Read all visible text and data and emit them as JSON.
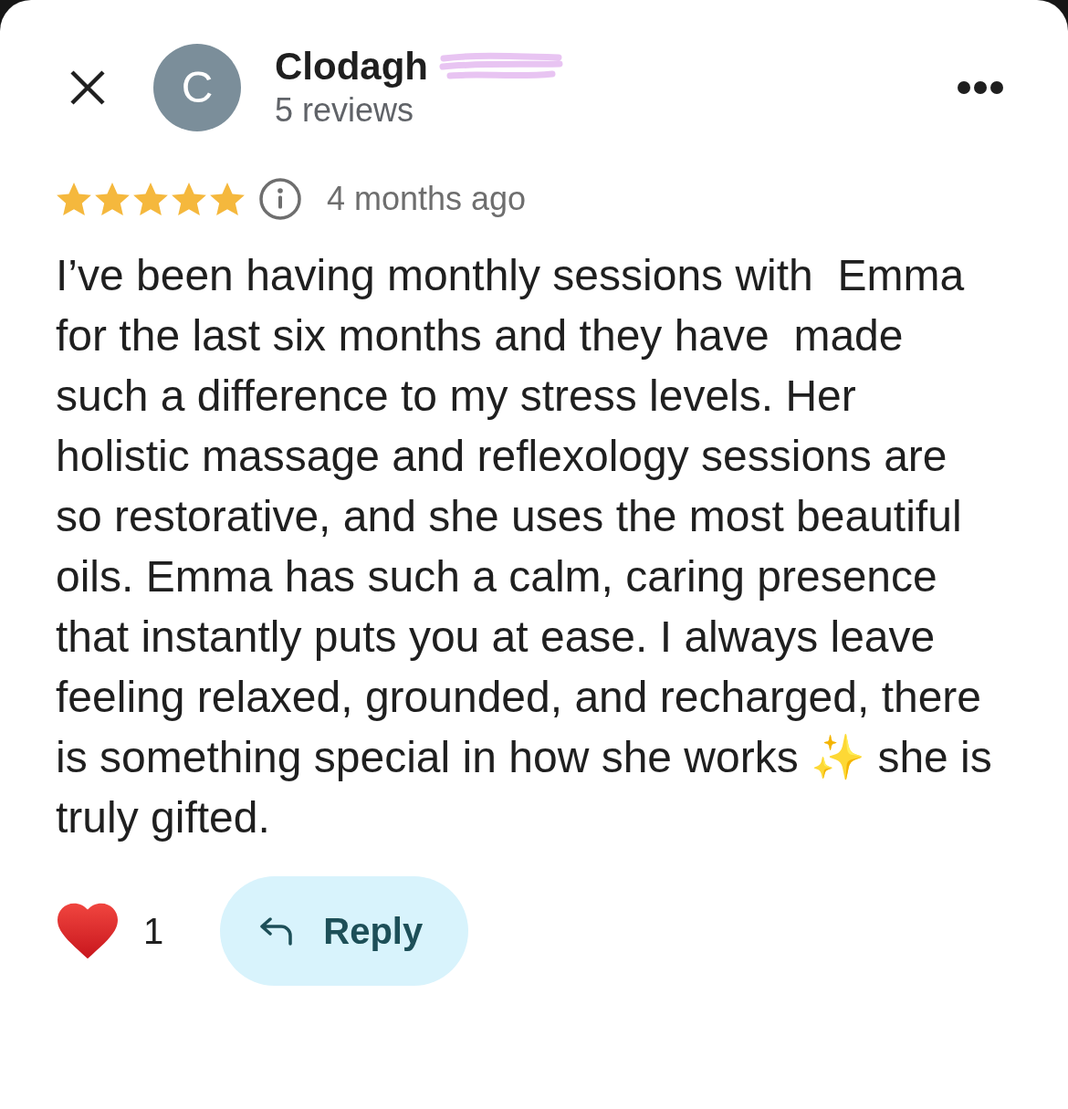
{
  "reviewer": {
    "initial": "C",
    "name": "Clodagh",
    "redacted": true,
    "review_count": "5 reviews"
  },
  "review": {
    "stars": 5,
    "time": "4 months ago",
    "text": "I’ve been having monthly sessions with  Emma\nfor the last six months and they have  made\nsuch a difference to my stress levels. Her\nholistic massage and reflexology sessions are\nso restorative, and she uses the most beautiful\noils. Emma has such a calm, caring presence\nthat instantly puts you at ease. I always leave\nfeeling relaxed, grounded, and recharged, there\nis something special in how she works ✨ she is\ntruly gifted."
  },
  "actions": {
    "reaction_count": "1",
    "reply": "Reply"
  }
}
